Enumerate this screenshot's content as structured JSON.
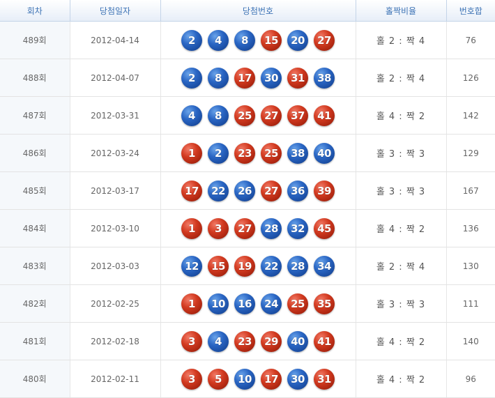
{
  "headers": {
    "round": "회차",
    "date": "당첨일자",
    "numbers": "당첨번호",
    "ratio": "홀짝비율",
    "sum": "번호합"
  },
  "colors": {
    "odd_ball": "#d23a20",
    "even_ball": "#2a66c4",
    "header_text": "#3d73b5"
  },
  "rows": [
    {
      "round": "489회",
      "date": "2012-04-14",
      "numbers": [
        2,
        4,
        8,
        15,
        20,
        27
      ],
      "ratio": "홀 2 : 짝 4",
      "sum": "76"
    },
    {
      "round": "488회",
      "date": "2012-04-07",
      "numbers": [
        2,
        8,
        17,
        30,
        31,
        38
      ],
      "ratio": "홀 2 : 짝 4",
      "sum": "126"
    },
    {
      "round": "487회",
      "date": "2012-03-31",
      "numbers": [
        4,
        8,
        25,
        27,
        37,
        41
      ],
      "ratio": "홀 4 : 짝 2",
      "sum": "142"
    },
    {
      "round": "486회",
      "date": "2012-03-24",
      "numbers": [
        1,
        2,
        23,
        25,
        38,
        40
      ],
      "ratio": "홀 3 : 짝 3",
      "sum": "129"
    },
    {
      "round": "485회",
      "date": "2012-03-17",
      "numbers": [
        17,
        22,
        26,
        27,
        36,
        39
      ],
      "ratio": "홀 3 : 짝 3",
      "sum": "167"
    },
    {
      "round": "484회",
      "date": "2012-03-10",
      "numbers": [
        1,
        3,
        27,
        28,
        32,
        45
      ],
      "ratio": "홀 4 : 짝 2",
      "sum": "136"
    },
    {
      "round": "483회",
      "date": "2012-03-03",
      "numbers": [
        12,
        15,
        19,
        22,
        28,
        34
      ],
      "ratio": "홀 2 : 짝 4",
      "sum": "130"
    },
    {
      "round": "482회",
      "date": "2012-02-25",
      "numbers": [
        1,
        10,
        16,
        24,
        25,
        35
      ],
      "ratio": "홀 3 : 짝 3",
      "sum": "111"
    },
    {
      "round": "481회",
      "date": "2012-02-18",
      "numbers": [
        3,
        4,
        23,
        29,
        40,
        41
      ],
      "ratio": "홀 4 : 짝 2",
      "sum": "140"
    },
    {
      "round": "480회",
      "date": "2012-02-11",
      "numbers": [
        3,
        5,
        10,
        17,
        30,
        31
      ],
      "ratio": "홀 4 : 짝 2",
      "sum": "96"
    }
  ]
}
